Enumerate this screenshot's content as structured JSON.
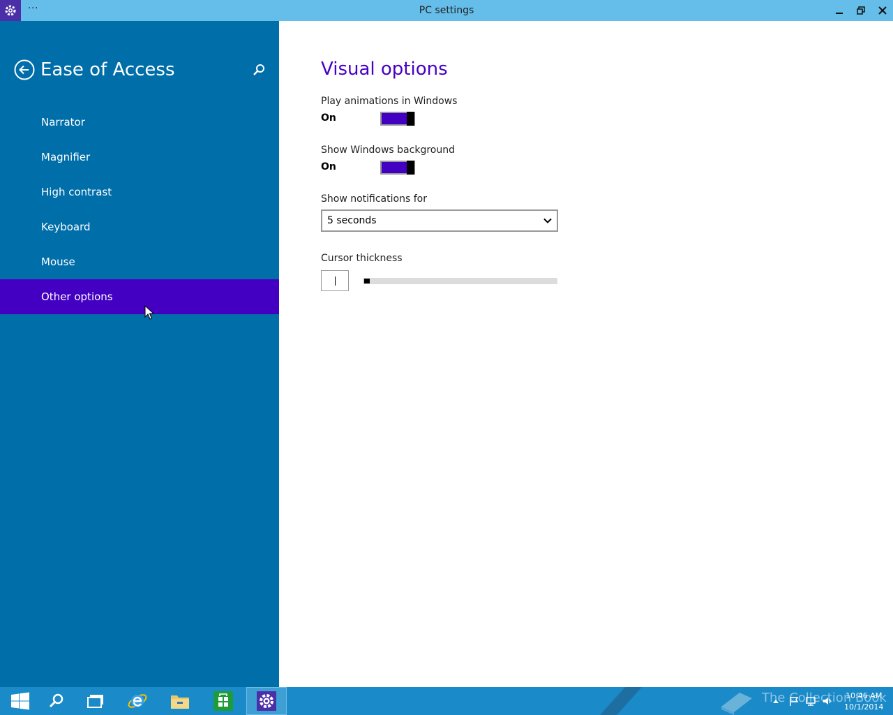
{
  "window": {
    "title": "PC settings",
    "menu_dots": "···",
    "controls": [
      "minimize",
      "restore",
      "close"
    ]
  },
  "sidebar": {
    "title": "Ease of Access",
    "items": [
      {
        "label": "Narrator",
        "selected": false
      },
      {
        "label": "Magnifier",
        "selected": false
      },
      {
        "label": "High contrast",
        "selected": false
      },
      {
        "label": "Keyboard",
        "selected": false
      },
      {
        "label": "Mouse",
        "selected": false
      },
      {
        "label": "Other options",
        "selected": true
      }
    ]
  },
  "main": {
    "title": "Visual options",
    "play_animations": {
      "label": "Play animations in Windows",
      "state": "On"
    },
    "show_background": {
      "label": "Show Windows background",
      "state": "On"
    },
    "notifications": {
      "label": "Show notifications for",
      "value": "5 seconds"
    },
    "cursor_thickness": {
      "label": "Cursor thickness",
      "value": 1
    }
  },
  "taskbar": {
    "items": [
      "start-icon",
      "search-icon",
      "task-view-icon",
      "internet-explorer-icon",
      "file-explorer-icon",
      "store-icon",
      "pc-settings-icon"
    ],
    "active": "pc-settings-icon",
    "watermark": "The Collection Book",
    "clock_time": "10:46 AM",
    "clock_date": "10/1/2014"
  },
  "colors": {
    "titlebar": "#65bde9",
    "sidebar": "#006ea9",
    "accent": "#4300c2",
    "heading": "#4600c4",
    "taskbar": "#1a8ac8"
  }
}
